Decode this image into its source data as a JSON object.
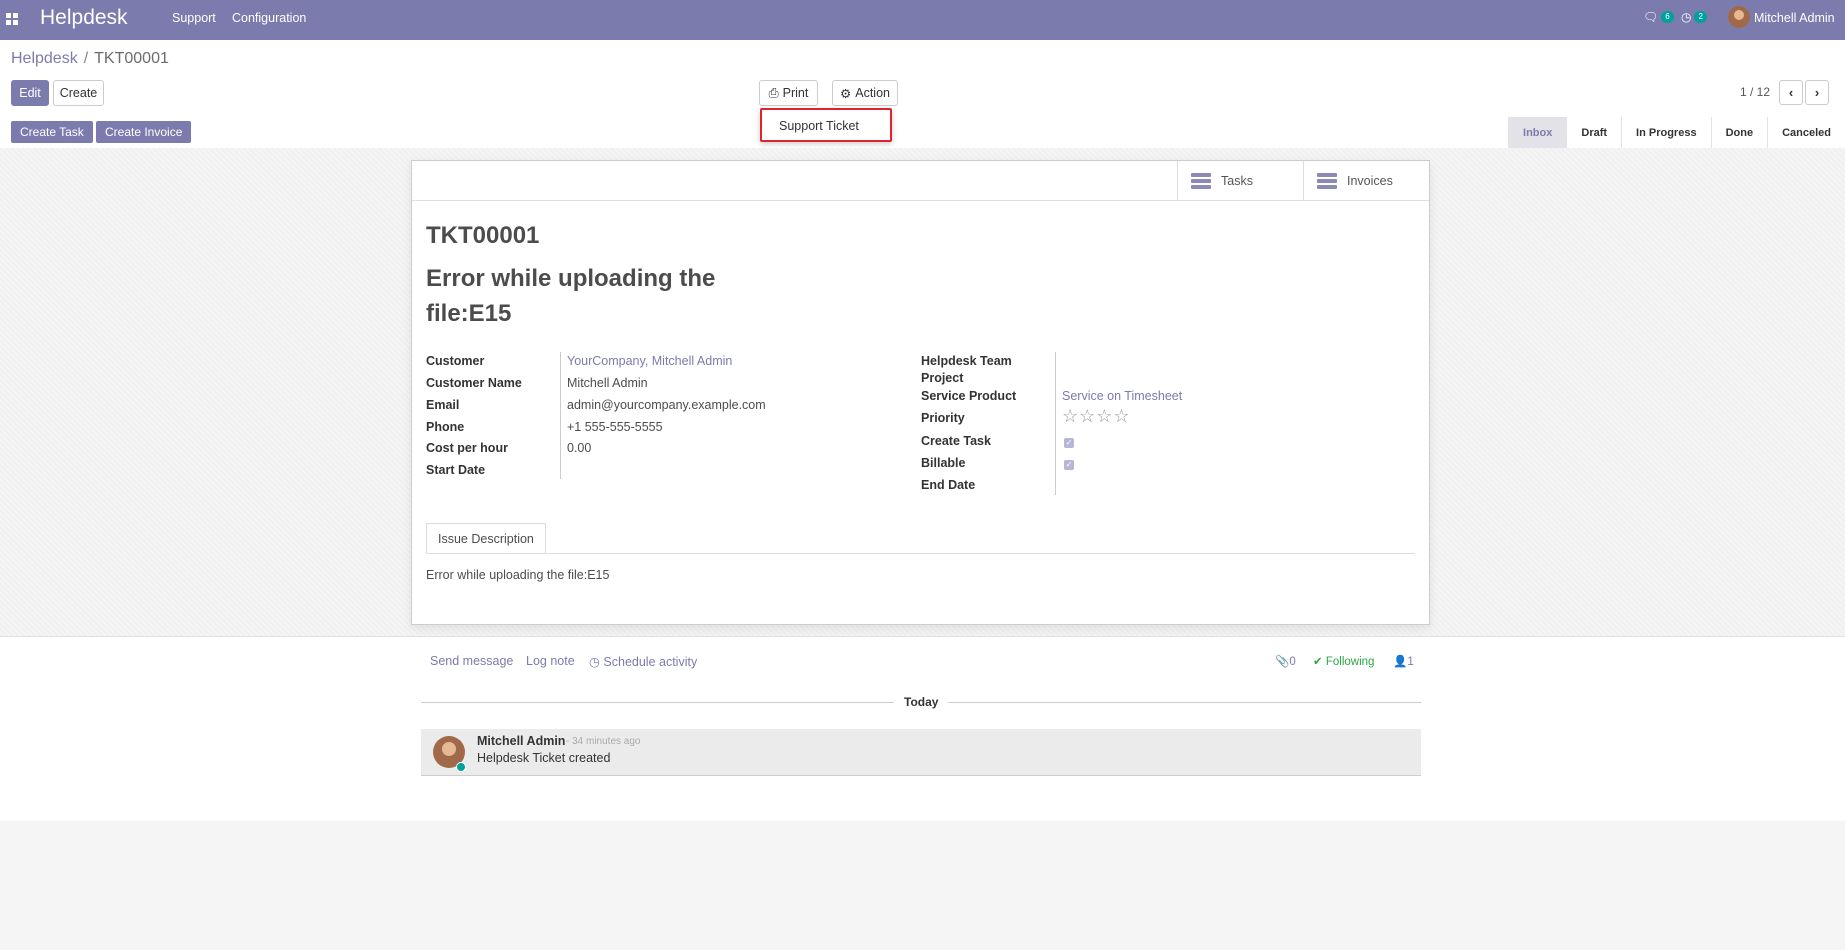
{
  "navbar": {
    "app_name": "Helpdesk",
    "menus": [
      "Support",
      "Configuration"
    ],
    "messages_count": "6",
    "activities_count": "2",
    "user_name": "Mitchell Admin",
    "accent_color": "#7c7bad"
  },
  "breadcrumb": {
    "parent": "Helpdesk",
    "current": "TKT00001"
  },
  "toolbar": {
    "edit_label": "Edit",
    "create_label": "Create",
    "print_label": "Print",
    "action_label": "Action",
    "pager": "1 / 12"
  },
  "print_dropdown": {
    "items": [
      "Support Ticket"
    ]
  },
  "statusbar": {
    "buttons": [
      "Create Task",
      "Create Invoice"
    ],
    "stages": [
      "Inbox",
      "Draft",
      "In Progress",
      "Done",
      "Canceled"
    ],
    "active_stage": "Inbox"
  },
  "smart_buttons": [
    "Tasks",
    "Invoices"
  ],
  "ticket": {
    "number": "TKT00001",
    "title": "Error while uploading the file:E15",
    "left_fields": [
      {
        "label": "Customer",
        "value": "YourCompany, Mitchell Admin"
      },
      {
        "label": "Customer Name",
        "value": "Mitchell Admin"
      },
      {
        "label": "Email",
        "value": "admin@yourcompany.example.com"
      },
      {
        "label": "Phone",
        "value": "+1 555-555-5555"
      },
      {
        "label": "Cost per hour",
        "value": "0.00"
      },
      {
        "label": "Start Date",
        "value": ""
      }
    ],
    "right_fields": {
      "helpdesk_team": "Helpdesk Team",
      "project": "Project",
      "service_product_label": "Service Product",
      "service_product_value": "Service on Timesheet",
      "priority_label": "Priority",
      "priority_value": 0,
      "create_task_label": "Create Task",
      "create_task_checked": true,
      "billable_label": "Billable",
      "billable_checked": true,
      "end_date_label": "End Date"
    },
    "tab_label": "Issue Description",
    "description": "Error while uploading the file:E15"
  },
  "chatter": {
    "send_message": "Send message",
    "log_note": "Log note",
    "schedule_activity": "Schedule activity",
    "attachments_count": "0",
    "following_label": "Following",
    "followers_count": "1",
    "date_separator": "Today",
    "message": {
      "author": "Mitchell Admin",
      "time": "- 34 minutes ago",
      "body": "Helpdesk Ticket created"
    }
  }
}
